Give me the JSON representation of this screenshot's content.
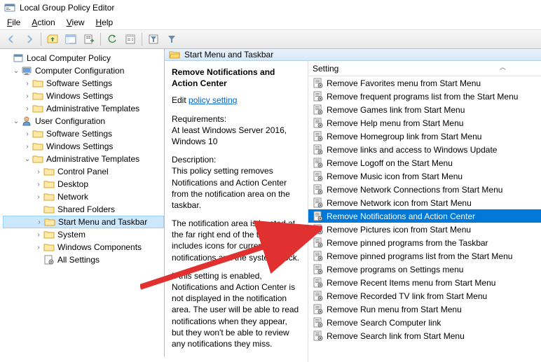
{
  "window": {
    "title": "Local Group Policy Editor"
  },
  "menu": {
    "file": "File",
    "action": "Action",
    "view": "View",
    "help": "Help"
  },
  "tree": {
    "root": "Local Computer Policy",
    "comp": "Computer Configuration",
    "comp_sw": "Software Settings",
    "comp_win": "Windows Settings",
    "comp_adm": "Administrative Templates",
    "user": "User Configuration",
    "user_sw": "Software Settings",
    "user_win": "Windows Settings",
    "user_adm": "Administrative Templates",
    "cp": "Control Panel",
    "desktop": "Desktop",
    "network": "Network",
    "shared": "Shared Folders",
    "start": "Start Menu and Taskbar",
    "system": "System",
    "wincomp": "Windows Components",
    "allset": "All Settings"
  },
  "header": {
    "title": "Start Menu and Taskbar"
  },
  "desc": {
    "title": "Remove Notifications and Action Center",
    "edit_prefix": "Edit ",
    "edit_link": "policy setting",
    "req_label": "Requirements:",
    "req_text": "At least Windows Server 2016, Windows 10",
    "desc_label": "Description:",
    "desc_p1": "This policy setting removes Notifications and Action Center from the notification area on the taskbar.",
    "desc_p2": "The notification area is located at the far right end of the taskbar and includes icons for current notifications and the system clock.",
    "desc_p3": "If this setting is enabled, Notifications and Action Center is not displayed in the notification area. The user will be able to read notifications when they appear, but they won't be able to review any notifications they miss."
  },
  "list": {
    "col": "Setting",
    "items": [
      "Remove Favorites menu from Start Menu",
      "Remove frequent programs list from the Start Menu",
      "Remove Games link from Start Menu",
      "Remove Help menu from Start Menu",
      "Remove Homegroup link from Start Menu",
      "Remove links and access to Windows Update",
      "Remove Logoff on the Start Menu",
      "Remove Music icon from Start Menu",
      "Remove Network Connections from Start Menu",
      "Remove Network icon from Start Menu",
      "Remove Notifications and Action Center",
      "Remove Pictures icon from Start Menu",
      "Remove pinned programs from the Taskbar",
      "Remove pinned programs list from the Start Menu",
      "Remove programs on Settings menu",
      "Remove Recent Items menu from Start Menu",
      "Remove Recorded TV link from Start Menu",
      "Remove Run menu from Start Menu",
      "Remove Search Computer link",
      "Remove Search link from Start Menu"
    ],
    "selected_index": 10
  }
}
